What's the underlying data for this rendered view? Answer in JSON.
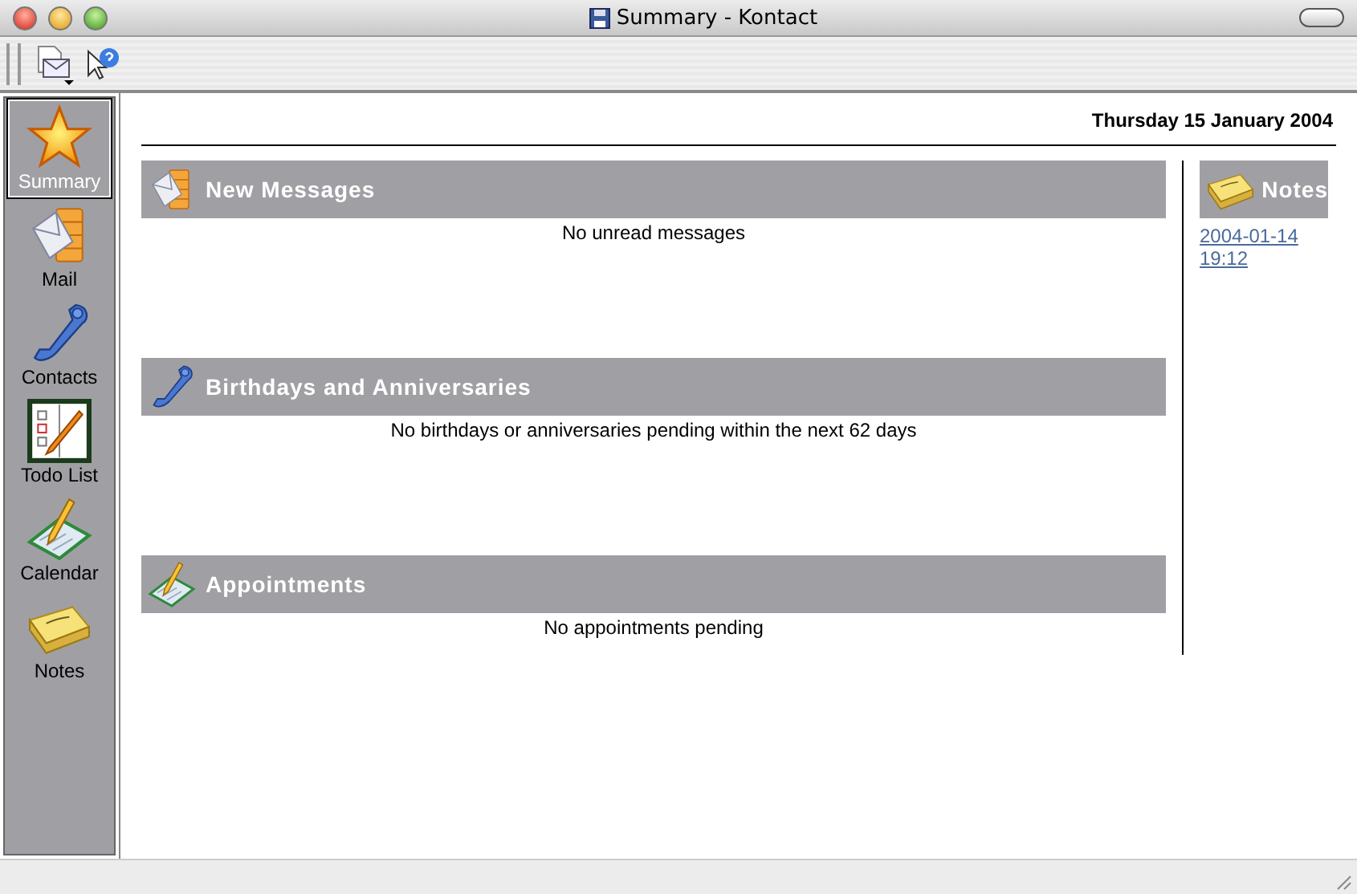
{
  "window": {
    "title": "Summary - Kontact"
  },
  "sidebar": {
    "items": [
      {
        "label": "Summary",
        "kind": "summary",
        "selected": true
      },
      {
        "label": "Mail",
        "kind": "mail",
        "selected": false
      },
      {
        "label": "Contacts",
        "kind": "contacts",
        "selected": false
      },
      {
        "label": "Todo List",
        "kind": "todo",
        "selected": false
      },
      {
        "label": "Calendar",
        "kind": "calendar",
        "selected": false
      },
      {
        "label": "Notes",
        "kind": "notes",
        "selected": false
      }
    ]
  },
  "date": "Thursday 15 January 2004",
  "sections": [
    {
      "title": "New Messages",
      "kind": "mail",
      "message": "No unread messages"
    },
    {
      "title": "Birthdays and Anniversaries",
      "kind": "contacts",
      "message": "No birthdays or anniversaries pending within the next 62 days"
    },
    {
      "title": "Appointments",
      "kind": "calendar",
      "message": "No appointments pending"
    }
  ],
  "notes": {
    "title": "Notes",
    "links": [
      "2004-01-14 19:12"
    ]
  }
}
